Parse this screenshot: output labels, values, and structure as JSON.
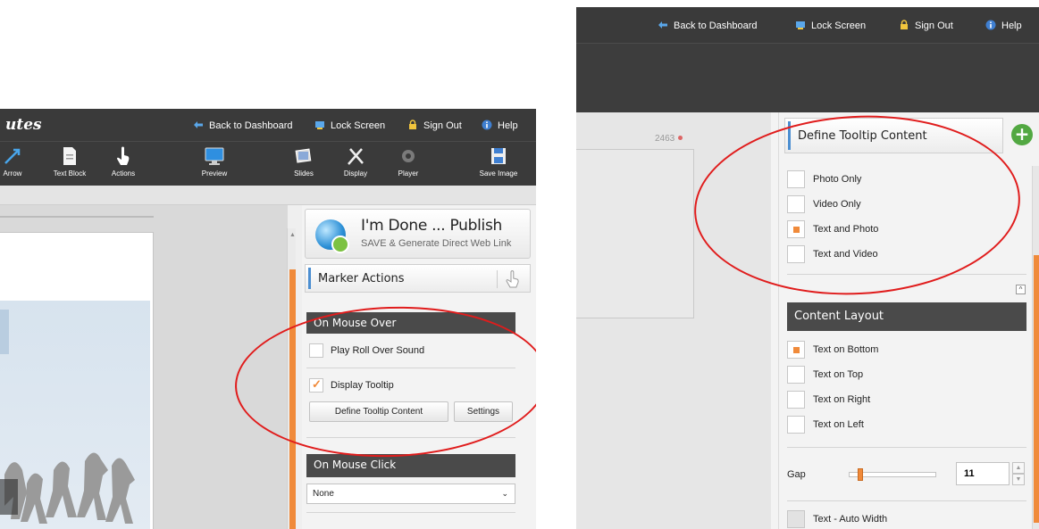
{
  "left": {
    "logo_fragment": "utes",
    "topbar": {
      "back": "Back to Dashboard",
      "lock": "Lock Screen",
      "signout": "Sign Out",
      "help": "Help"
    },
    "toolbar": {
      "arrow": "Arrow",
      "text_block": "Text Block",
      "actions": "Actions",
      "preview": "Preview",
      "slides": "Slides",
      "display": "Display",
      "player": "Player",
      "save_image": "Save Image"
    },
    "publish": {
      "title": "I'm Done ... Publish",
      "subtitle": "SAVE & Generate Direct Web Link"
    },
    "marker_actions": "Marker Actions",
    "on_mouse_over": "On Mouse Over",
    "play_roll_over_sound": "Play Roll Over Sound",
    "display_tooltip": "Display Tooltip",
    "define_tooltip_content": "Define Tooltip Content",
    "settings": "Settings",
    "on_mouse_click": "On Mouse Click",
    "mouse_click_value": "None",
    "check_mark": "✓"
  },
  "right": {
    "topbar": {
      "back": "Back to Dashboard",
      "lock": "Lock Screen",
      "signout": "Sign Out",
      "help": "Help"
    },
    "canvas_number": "2463",
    "define_tooltip_content": "Define Tooltip Content",
    "plus": "+",
    "options": [
      "Photo Only",
      "Video Only",
      "Text and Photo",
      "Text and Video"
    ],
    "selected_option": "Text and Photo",
    "content_layout": "Content Layout",
    "layouts": [
      "Text on Bottom",
      "Text on Top",
      "Text on Right",
      "Text on Left"
    ],
    "selected_layout": "Text on Bottom",
    "gap_label": "Gap",
    "gap_value": "11",
    "auto_width": "Text - Auto Width",
    "collapse_glyph": "^"
  },
  "colors": {
    "accent_orange": "#f08a3a",
    "highlight_red": "#e01c1c",
    "header_dark": "#3a3a3a",
    "marker_blue": "#4b8ed1",
    "plus_green": "#52a842"
  }
}
